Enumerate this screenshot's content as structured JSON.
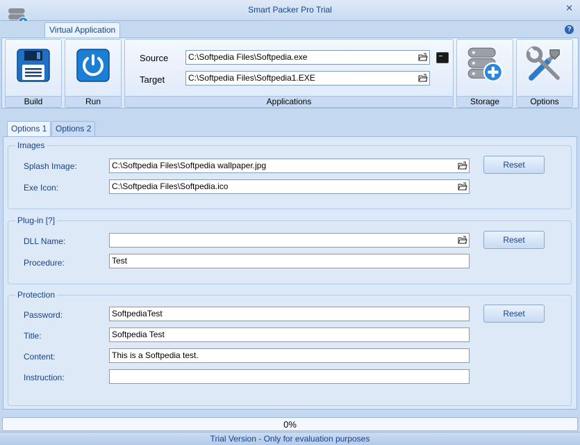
{
  "window": {
    "title": "Smart Packer Pro Trial",
    "close_glyph": "✕",
    "help_glyph": "?"
  },
  "ribbon_tab": "Virtual Application",
  "ribbon": {
    "build_label": "Build",
    "run_label": "Run",
    "applications_label": "Applications",
    "storage_label": "Storage",
    "options_label": "Options",
    "source_label": "Source",
    "source_value": "C:\\Softpedia Files\\Softpedia.exe",
    "target_label": "Target",
    "target_value": "C:\\Softpedia Files\\Softpedia1.EXE"
  },
  "tabs": {
    "options1": "Options 1",
    "options2": "Options 2"
  },
  "images": {
    "legend": "Images",
    "splash_label": "Splash Image:",
    "splash_value": "C:\\Softpedia Files\\Softpedia wallpaper.jpg",
    "exe_icon_label": "Exe Icon:",
    "exe_icon_value": "C:\\Softpedia Files\\Softpedia.ico",
    "reset": "Reset"
  },
  "plugin": {
    "legend": "Plug-in [?]",
    "dll_label": "DLL Name:",
    "dll_value": "",
    "procedure_label": "Procedure:",
    "procedure_value": "Test",
    "reset": "Reset"
  },
  "protection": {
    "legend": "Protection",
    "password_label": "Password:",
    "password_value": "SoftpediaTest",
    "title_label": "Title:",
    "title_value": "Softpedia Test",
    "content_label": "Content:",
    "content_value": "This is a Softpedia test.",
    "instruction_label": "Instruction:",
    "instruction_value": "",
    "reset": "Reset"
  },
  "progress": {
    "text": "0%",
    "value": 0
  },
  "status": "Trial Version - Only for evaluation purposes",
  "colors": {
    "accent": "#15428b",
    "frame": "#c4d8f0",
    "border": "#9cb7db"
  }
}
